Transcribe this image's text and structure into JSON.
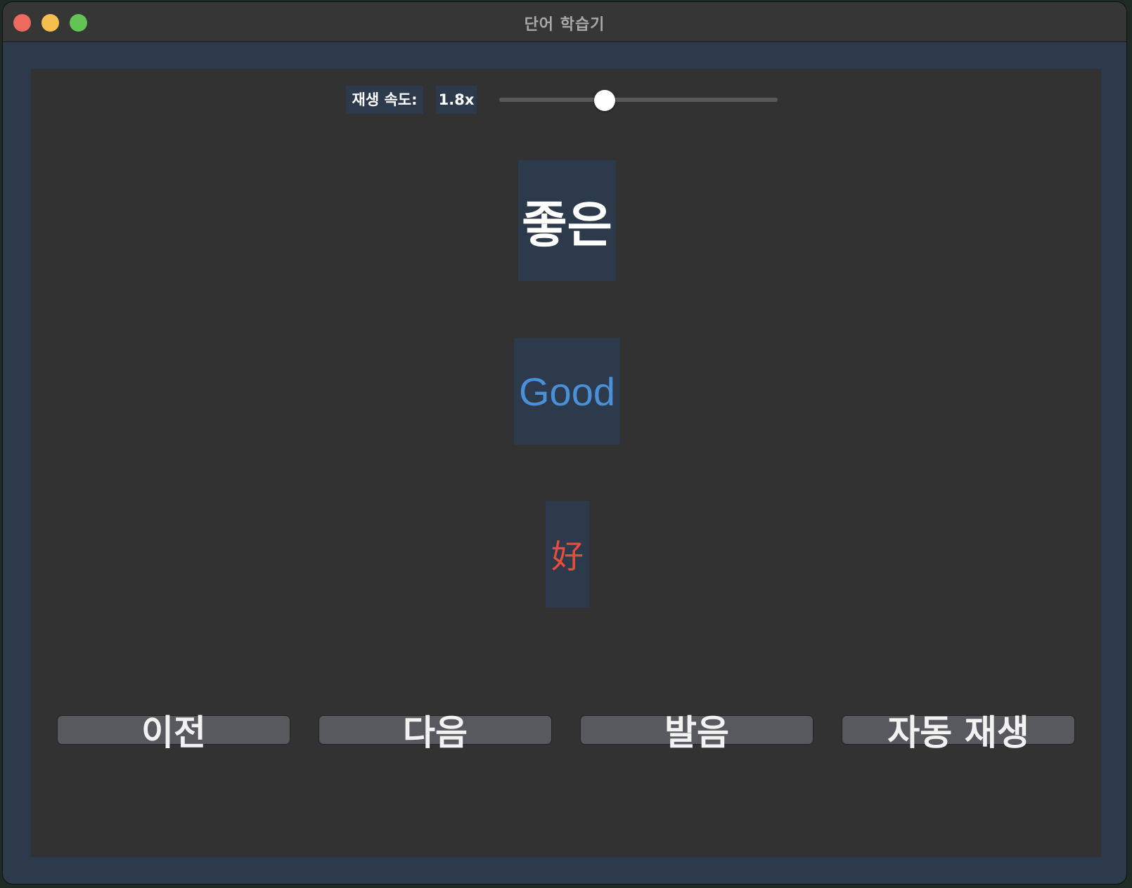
{
  "window": {
    "title": "단어 학습기"
  },
  "speed": {
    "label": "재생 속도:",
    "value_text": "1.8x",
    "slider_fraction": 0.38
  },
  "word": {
    "korean": "좋은",
    "english": "Good",
    "hanja": "好"
  },
  "colors": {
    "english": "#4a90d9",
    "hanja": "#e74c3c",
    "card_bg": "#2c3a4c",
    "content_bg": "#323232",
    "window_bg": "#2d3a4b"
  },
  "buttons": {
    "prev": "이전",
    "next": "다음",
    "pronounce": "발음",
    "autoplay": "자동 재생"
  }
}
